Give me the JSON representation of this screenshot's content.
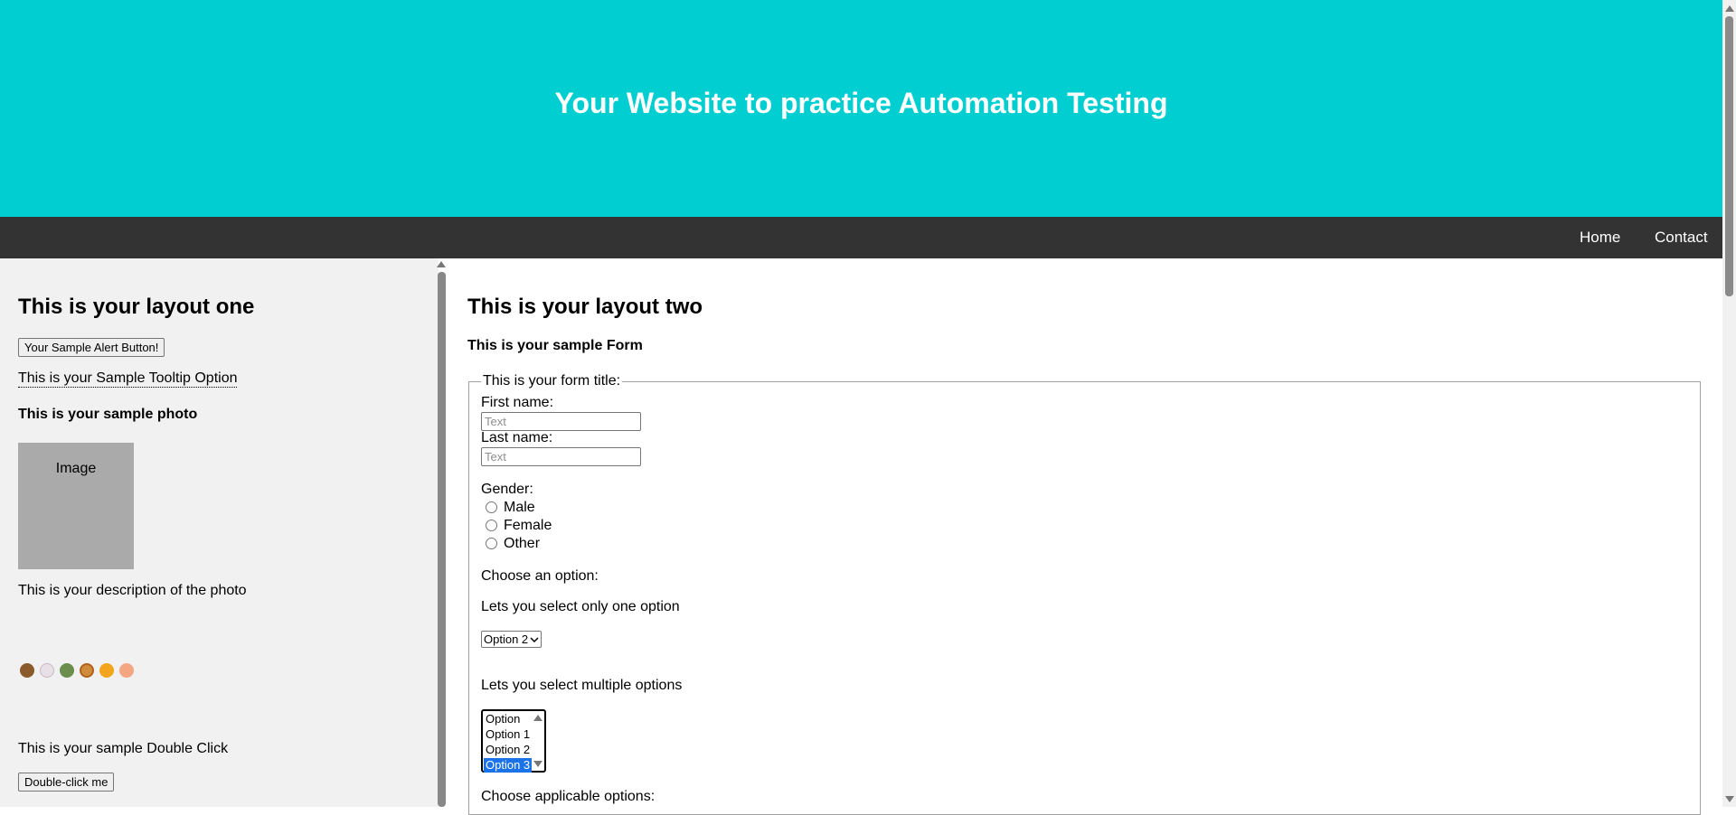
{
  "header": {
    "title": "Your Website to practice Automation Testing",
    "background_color": "#00ced1"
  },
  "nav": {
    "items": [
      {
        "label": "Home"
      },
      {
        "label": "Contact"
      }
    ],
    "background_color": "#333333"
  },
  "layout_one": {
    "heading": "This is your layout one",
    "alert_button_label": "Your Sample Alert Button!",
    "tooltip_option": "This is your Sample Tooltip Option",
    "photo_heading": "This is your sample photo",
    "photo_placeholder": "Image",
    "photo_description": "This is your description of the photo",
    "icons": [
      "brown-creature-icon",
      "white-creature-icon",
      "green-creature-icon",
      "pretzel-icon",
      "orange-creature-icon",
      "peach-creature-icon"
    ],
    "double_click_label": "This is your sample Double Click",
    "double_click_button": "Double-click me"
  },
  "layout_two": {
    "heading": "This is your layout two",
    "form_heading": "This is your sample Form",
    "form": {
      "legend": "This is your form title:",
      "first_name_label": "First name:",
      "first_name_placeholder": "Text",
      "last_name_label": "Last name:",
      "last_name_placeholder": "Text",
      "gender_label": "Gender:",
      "gender_options": [
        "Male",
        "Female",
        "Other"
      ],
      "choose_option_label": "Choose an option:",
      "single_select_label": "Lets you select only one option",
      "single_select_value": "Option 2",
      "multi_select_label": "Lets you select multiple options",
      "multi_select_options": [
        "Option",
        "Option 1",
        "Option 2",
        "Option 3"
      ],
      "multi_select_selected": "Option 3",
      "applicable_options_label": "Choose applicable options:"
    }
  }
}
